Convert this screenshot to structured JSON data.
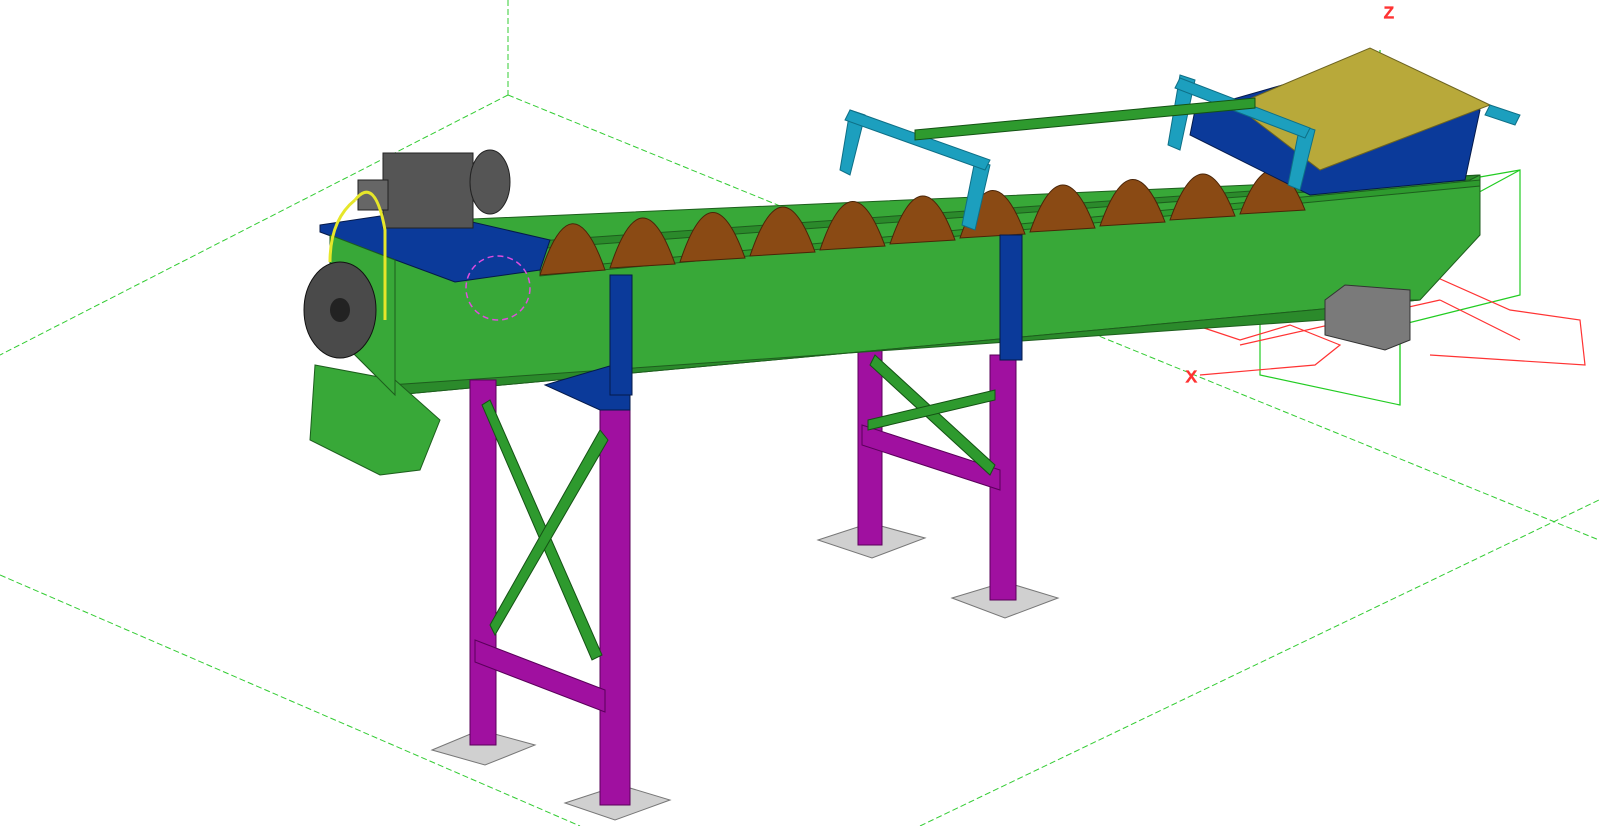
{
  "viewport": {
    "background": "#ffffff",
    "grid_color": "#33cc33",
    "ucs_color": "#ff3333",
    "axis_labels": {
      "z": "Z",
      "x": "X"
    }
  },
  "model": {
    "colors": {
      "trough": "#38a838",
      "trough_dark": "#2b8a2b",
      "screw": "#8a4a14",
      "end_plates": "#0b3a9a",
      "support_legs": "#a010a0",
      "bracing": "#2e9a2e",
      "handrail": "#1c9fbe",
      "grating": "#b8a93a",
      "motor": "#555555",
      "base_plates": "#d0d0d0",
      "bolts": "#8a5a2a"
    }
  }
}
